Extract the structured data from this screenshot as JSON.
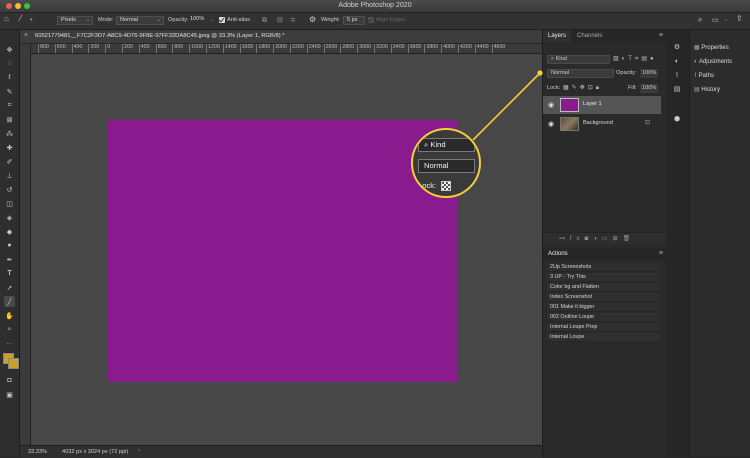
{
  "window": {
    "title": "Adobe Photoshop 2020"
  },
  "options_bar": {
    "units": "Pixels",
    "mode_label": "Mode:",
    "mode_value": "Normal",
    "opacity_label": "Opacity:",
    "opacity_value": "100%",
    "antialias_label": "Anti-alias",
    "weight_label": "Weight:",
    "weight_value": "5 px",
    "align_edges_label": "Align Edges"
  },
  "document": {
    "tab_title": "60521779481__F7C2F3D7-A8C9-4D76-9F8E-97FF32DA8C45.jpeg @ 33.3% (Layer 1, RGB/8) *",
    "canvas_color": "#8a1b8f",
    "ruler_ticks": [
      "800",
      "600",
      "400",
      "200",
      "0",
      "200",
      "400",
      "600",
      "800",
      "1000",
      "1200",
      "1400",
      "1600",
      "1800",
      "2000",
      "2200",
      "2400",
      "2600",
      "2800",
      "3000",
      "3200",
      "3400",
      "3600",
      "3800",
      "4000",
      "4200",
      "4400",
      "4600"
    ]
  },
  "status": {
    "zoom": "33.33%",
    "info": "4032 px x 3024 px (72 ppi)"
  },
  "layers_panel": {
    "tabs": [
      "Layers",
      "Channels"
    ],
    "filter_kind": "Kind",
    "blend_mode": "Normal",
    "opacity_label": "Opacity:",
    "opacity_value": "100%",
    "lock_label": "Lock:",
    "fill_label": "Fill:",
    "fill_value": "100%",
    "layers": [
      {
        "name": "Layer 1",
        "selected": true
      },
      {
        "name": "Background",
        "locked": true
      }
    ]
  },
  "actions_panel": {
    "title": "Actions",
    "items": [
      "2Up Screenshots",
      "3 UP - Try This",
      "Color bg and Flatten",
      "Index Screenshot",
      "001 Make it bigger",
      "002 Outline Loupe",
      "Internal Loupe Prep",
      "Internal Loupe"
    ]
  },
  "right_panel": {
    "items": [
      "Properties",
      "Adjustments",
      "Paths",
      "History"
    ]
  },
  "callout": {
    "color": "#f3cf3a",
    "kind_label": "Kind",
    "blend_label": "Normal",
    "lock_label": "Lock:"
  }
}
